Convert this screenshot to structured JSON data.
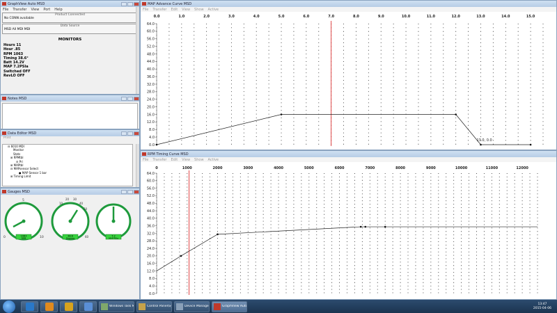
{
  "graphview": {
    "title": "GraphView Auto MSD",
    "menu": [
      "File",
      "Transfer",
      "View",
      "Port",
      "Help"
    ],
    "product_label": "Product Connected",
    "product_value": "No CONN available",
    "data_source_label": "Data Source",
    "data_source_value": "MSD All MDI MDI",
    "monitors_heading": "MONITORS",
    "monitors": [
      "Hours   11",
      "Hour  .85",
      "RPM  1063",
      "Timing  38.6°",
      "Batt  14.2V",
      "MAP  7.2PSIa",
      "Swltched OFF",
      "RevLO OFF"
    ]
  },
  "notes": {
    "title": "Notes   MSD"
  },
  "data_editor": {
    "title": "Data Editor   MSD",
    "toolbar": "Print",
    "tree": [
      "6010 MDI",
      "Monitor",
      "Stats",
      "RPMtbl",
      "Pri",
      "MAPtbl",
      "MAPsensor Select",
      "MAP Sensor 1 bar",
      "Timing Limit"
    ]
  },
  "gauges": {
    "title": "Gauges   MSD",
    "items": [
      {
        "scale": [
          "0",
          "5",
          "10"
        ],
        "value": "1063",
        "unit": "RPM"
      },
      {
        "scale": [
          "10",
          "20",
          "30",
          "40",
          "50",
          "60"
        ],
        "value": "38.6",
        "unit": "Degrees"
      },
      {
        "scale": [],
        "value": "7.2",
        "unit": "MAP PSIa"
      }
    ]
  },
  "map_curve": {
    "title": "MAP Advance Curve   MSD",
    "menu": [
      "File",
      "Transfer",
      "Edit",
      "View",
      "Show",
      "Active"
    ],
    "annotation": "13.0, 0.0"
  },
  "rpm_curve": {
    "title": "RPM Timing Curve   MSD",
    "menu": [
      "File",
      "Transfer",
      "Edit",
      "View",
      "Show",
      "Active"
    ]
  },
  "chart_data": [
    {
      "type": "line",
      "title": "MAP Advance Curve",
      "x_ticks": [
        "0.0",
        "1.0",
        "2.0",
        "3.0",
        "4.0",
        "5.0",
        "6.0",
        "7.0",
        "8.0",
        "9.0",
        "10.0",
        "11.0",
        "12.0",
        "13.0",
        "14.0",
        "15.0"
      ],
      "y_ticks": [
        "64.0",
        "60.0",
        "56.0",
        "52.0",
        "48.0",
        "44.0",
        "40.0",
        "36.0",
        "32.0",
        "28.0",
        "24.0",
        "20.0",
        "16.0",
        "12.0",
        "8.0",
        "4.0",
        "0.0"
      ],
      "xlim": [
        0,
        15.5
      ],
      "ylim": [
        0,
        64
      ],
      "series": [
        {
          "x": [
            0,
            5,
            12,
            13,
            15
          ],
          "y": [
            0,
            16,
            16,
            0,
            0
          ]
        }
      ],
      "cursor_x": 7.0,
      "grid": true
    },
    {
      "type": "line",
      "title": "RPM Timing Curve",
      "x_ticks": [
        "0",
        "1000",
        "2000",
        "3000",
        "4000",
        "5000",
        "6000",
        "7000",
        "8000",
        "9000",
        "10000",
        "11000",
        "12000"
      ],
      "y_ticks": [
        "64.0",
        "60.0",
        "56.0",
        "52.0",
        "48.0",
        "44.0",
        "40.0",
        "36.0",
        "32.0",
        "28.0",
        "24.0",
        "20.0",
        "16.0",
        "12.0",
        "8.0",
        "4.0",
        "0.0"
      ],
      "xlim": [
        0,
        12500
      ],
      "ylim": [
        0,
        64
      ],
      "series": [
        {
          "x": [
            0,
            800,
            2000,
            6700,
            6850,
            7500,
            9800,
            12500
          ],
          "y": [
            12,
            20,
            31.5,
            35.5,
            35.5,
            35.5,
            35.5,
            35.5
          ]
        }
      ],
      "markers": [
        800,
        2000,
        6700,
        6850,
        7500
      ],
      "cursor_x": 1063,
      "grid": true
    }
  ],
  "taskbar": {
    "items": [
      {
        "label": "",
        "color": "#2a78c8"
      },
      {
        "label": "",
        "color": "#e08a1e"
      },
      {
        "label": "",
        "color": "#d8a31d"
      },
      {
        "label": "",
        "color": "#5a8fd6"
      },
      {
        "label": "Windows Task M...",
        "color": "#7fa86b"
      },
      {
        "label": "Control Panel\\Sys...",
        "color": "#c6a24a"
      },
      {
        "label": "Device Manager",
        "color": "#8aa0b8"
      },
      {
        "label": "GraphView Auto ...",
        "color": "#c0392b"
      }
    ],
    "time": "13:47",
    "date": "2015-04-06"
  }
}
